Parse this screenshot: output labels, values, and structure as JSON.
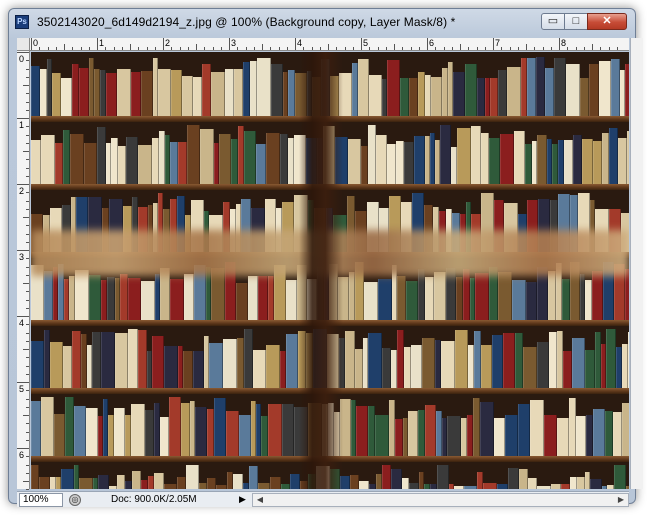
{
  "window": {
    "app_logo": "Ps",
    "title": "3502143020_6d149d2194_z.jpg @ 100% (Background copy, Layer Mask/8) *",
    "minimize_glyph": "▭",
    "maximize_glyph": "□",
    "close_glyph": "✕"
  },
  "rulers": {
    "top_labels": [
      "0",
      "1",
      "2",
      "3",
      "4",
      "5",
      "6",
      "7",
      "8"
    ],
    "left_labels": [
      "0",
      "1",
      "2",
      "3",
      "4",
      "5",
      "6"
    ]
  },
  "status": {
    "zoom": "100%",
    "doc_info": "Doc: 900.0K/2.05M",
    "menu_arrow": "▶",
    "scroll_left": "◀",
    "scroll_right": "▶"
  },
  "palette": {
    "book_colors": [
      "#e7d9b8",
      "#1f3f6a",
      "#8b1e1e",
      "#d8c7a0",
      "#2f5a3a",
      "#6a4020",
      "#c9b58a",
      "#f0e6cc",
      "#3a3a3a",
      "#a33a2a",
      "#5a7a9a",
      "#b89a5a",
      "#e9e1c8",
      "#2a2a40",
      "#7a5a30"
    ]
  }
}
